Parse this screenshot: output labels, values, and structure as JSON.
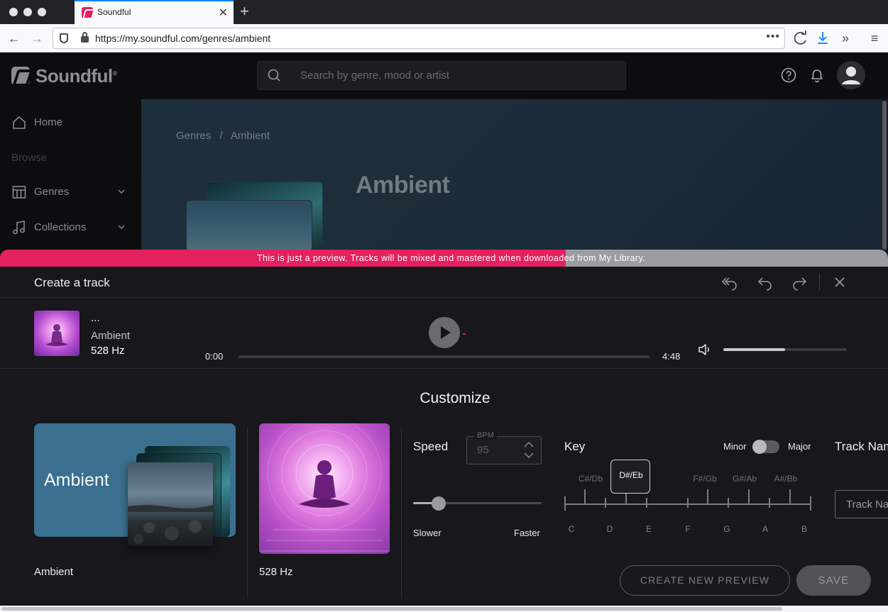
{
  "browser": {
    "tab_title": "Soundful",
    "url": "https://my.soundful.com/genres/ambient",
    "url_more": "•••"
  },
  "app": {
    "logo_text": "Soundful",
    "logo_mark": "®",
    "search_placeholder": "Search by genre, mood or artist"
  },
  "sidebar": {
    "home": "Home",
    "browse": "Browse",
    "genres": "Genres",
    "collections": "Collections"
  },
  "hero": {
    "breadcrumb_root": "Genres",
    "breadcrumb_sep": "/",
    "breadcrumb_current": "Ambient",
    "title": "Ambient"
  },
  "banner": {
    "text": "This is just a preview. Tracks will be mixed and mastered when downloaded from My Library.",
    "progress": 0.637,
    "accent": "#e5205f"
  },
  "modal": {
    "title": "Create a track",
    "player": {
      "title": "...",
      "genre": "Ambient",
      "variant": "528 Hz",
      "current_time": "0:00",
      "duration": "4:48",
      "progress": 0,
      "volume": 0.5
    },
    "customize": {
      "title": "Customize",
      "genre_card_label": "Ambient",
      "genre_name": "Ambient",
      "variant_name": "528 Hz",
      "speed": {
        "label": "Speed",
        "bpm_caption": "BPM",
        "bpm_value": "95",
        "slower": "Slower",
        "faster": "Faster",
        "level": 0.2
      },
      "key": {
        "label": "Key",
        "minor": "Minor",
        "major": "Major",
        "mode": "Minor",
        "sharps": [
          "C#/Db",
          "D#/Eb",
          "F#/Gb",
          "G#/Ab",
          "A#/Bb"
        ],
        "naturals": [
          "C",
          "D",
          "E",
          "F",
          "G",
          "A",
          "B"
        ],
        "selected": "D#/Eb"
      },
      "track_name": {
        "label": "Track Name",
        "placeholder": "Track Name"
      },
      "create_preview": "CREATE NEW PREVIEW",
      "save": "SAVE"
    }
  }
}
